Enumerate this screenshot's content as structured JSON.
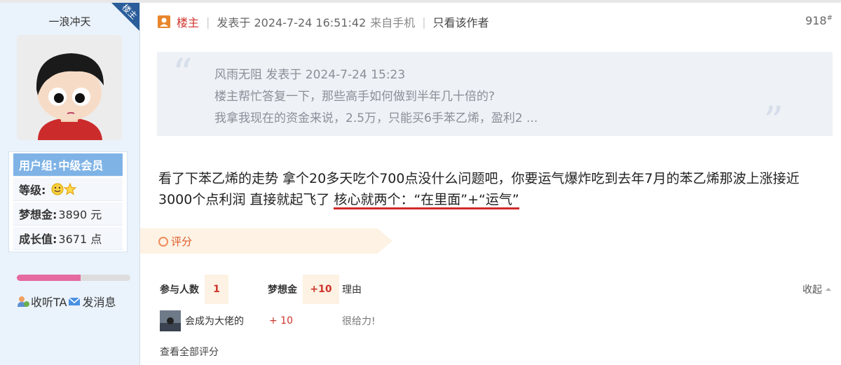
{
  "sidebar": {
    "username": "一浪冲天",
    "owner_badge": "楼主",
    "stats": [
      {
        "label": "用户组:",
        "value": "中级会员"
      },
      {
        "label": "等级:",
        "value": ""
      },
      {
        "label": "梦想金:",
        "value": "3890 元"
      },
      {
        "label": "成长值:",
        "value": "3671 点"
      }
    ],
    "progress_fraction": 0.56,
    "follow_label": "收听TA",
    "message_label": "发消息"
  },
  "post": {
    "owner_label": "楼主",
    "posted_at": "发表于 2024-7-24 16:51:42",
    "source": "来自手机",
    "only_author": "只看该作者",
    "floor": "918",
    "floor_mark": "#",
    "quote": {
      "line1": "风雨无阻 发表于 2024-7-24 15:23",
      "line2": "楼主帮忙答复一下，那些高手如何做到半年几十倍的?",
      "line3": "我拿我现在的资金来说，2.5万，只能买6手苯乙烯，盈利2 ..."
    },
    "body_main": "看了下苯乙烯的走势 拿个20多天吃个700点没什么问题吧，你要运气爆炸吃到去年7月的苯乙烯那波上涨接近3000个点利润 直接就起飞了 ",
    "body_highlight": "核心就两个：“在里面”+“运气”"
  },
  "rating": {
    "label": "评分",
    "participants_label": "参与人数",
    "participants_count": "1",
    "currency_label": "梦想金",
    "currency_total": "+10",
    "reason_label": "理由",
    "collapse_label": "收起",
    "rows": [
      {
        "user": "会成为大佬的",
        "amount": "+ 10",
        "reason": "很给力!"
      }
    ],
    "view_all": "查看全部评分"
  },
  "colors": {
    "accent": "#d0342c",
    "sidebar_bg": "#eaf2fb",
    "group_bg": "#7fb3e6",
    "rating_bg": "#fdf2e3"
  }
}
